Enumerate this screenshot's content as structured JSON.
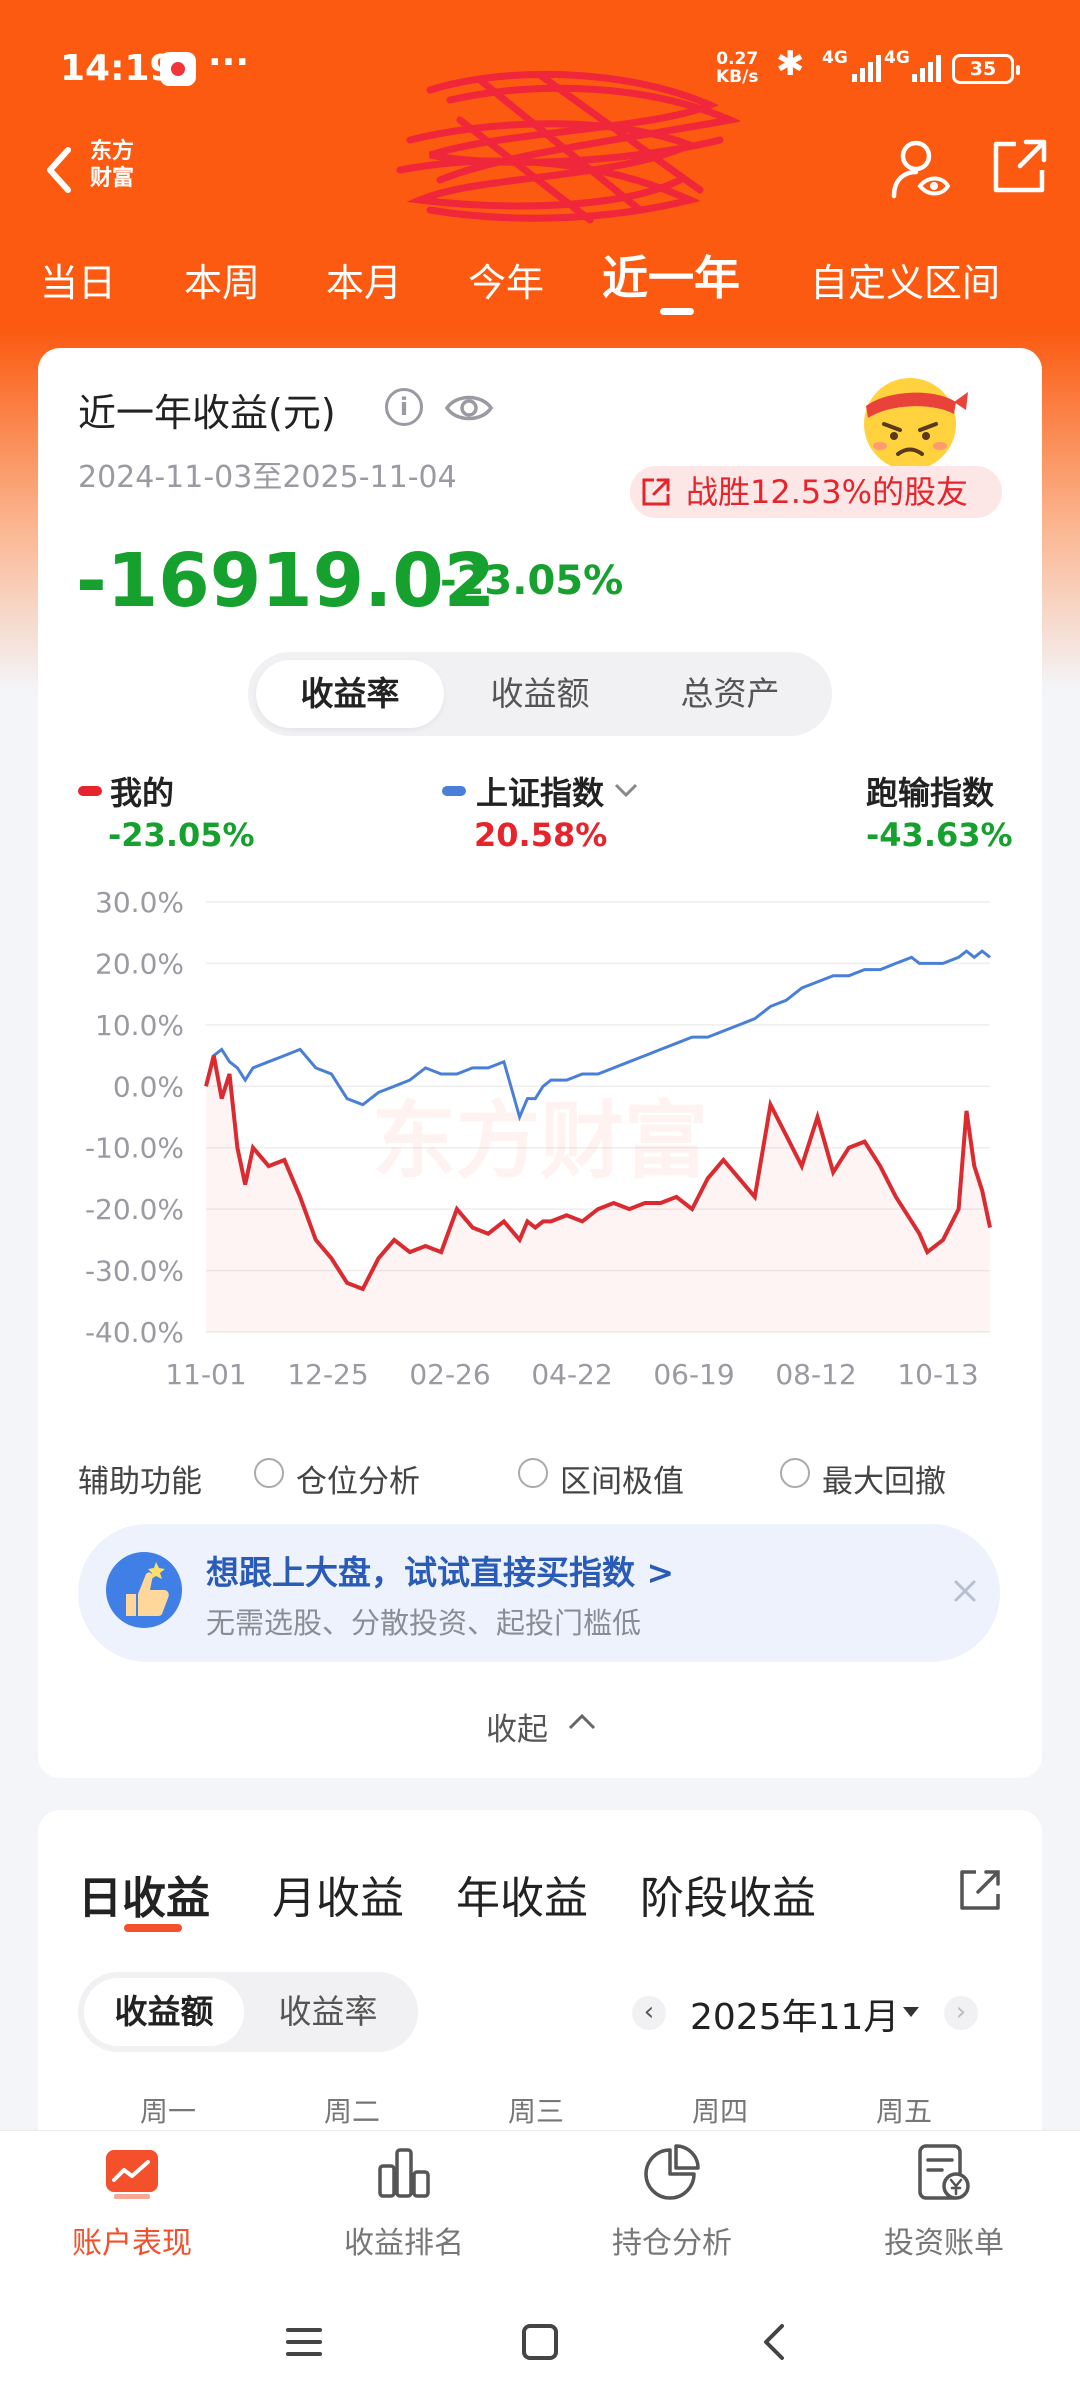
{
  "status_bar": {
    "time": "14:19",
    "more": "···",
    "net_speed_value": "0.27",
    "net_speed_unit": "KB/s",
    "signal_1": "4G",
    "signal_2": "4G",
    "battery": "35",
    "icons": [
      "app-notification-icon",
      "bluetooth-icon",
      "signal-icon",
      "battery-icon"
    ]
  },
  "header": {
    "back_icon": "back-arrow-icon",
    "brand_line1": "东方",
    "brand_line2": "财富",
    "title_obscured": "redacted-scribble",
    "user_icon": "user-eye-icon",
    "share_icon": "share-icon"
  },
  "period_tabs": [
    {
      "label": "当日"
    },
    {
      "label": "本周"
    },
    {
      "label": "本月"
    },
    {
      "label": "今年"
    },
    {
      "label": "近一年",
      "active": true
    },
    {
      "label": "自定义区间"
    }
  ],
  "summary": {
    "title": "近一年收益(元)",
    "date_range": "2024-11-03至2025-11-04",
    "beat_text": "战胜12.53%的股友",
    "total_value": "-16919.02",
    "total_pct": "-23.05%"
  },
  "segment": [
    "收益率",
    "收益额",
    "总资产"
  ],
  "legend": {
    "mine_name": "我的",
    "mine_value": "-23.05%",
    "index_name": "上证指数",
    "index_value": "20.58%",
    "diff_name": "跑输指数",
    "diff_value": "-43.63%"
  },
  "colors": {
    "brand_orange": "#fb5a10",
    "loss_green": "#16a02e",
    "gain_red": "#e5252b",
    "mine_line": "#d92b30",
    "index_line": "#4a7fd8",
    "active_accent": "#f4502b"
  },
  "chart_data": {
    "type": "line",
    "title": "",
    "watermark": "东方财富",
    "ylim": [
      -40,
      30
    ],
    "yticks": [
      "30.0%",
      "20.0%",
      "10.0%",
      "0.0%",
      "-10.0%",
      "-20.0%",
      "-30.0%",
      "-40.0%"
    ],
    "xticks": [
      "11-01",
      "12-25",
      "02-26",
      "04-22",
      "06-19",
      "08-12",
      "10-13"
    ],
    "x": [
      0,
      0.01,
      0.02,
      0.03,
      0.04,
      0.05,
      0.06,
      0.08,
      0.1,
      0.12,
      0.14,
      0.16,
      0.18,
      0.2,
      0.22,
      0.24,
      0.26,
      0.28,
      0.3,
      0.32,
      0.34,
      0.36,
      0.38,
      0.4,
      0.41,
      0.42,
      0.43,
      0.44,
      0.46,
      0.48,
      0.5,
      0.52,
      0.54,
      0.56,
      0.58,
      0.6,
      0.62,
      0.64,
      0.66,
      0.68,
      0.7,
      0.72,
      0.74,
      0.76,
      0.78,
      0.8,
      0.82,
      0.84,
      0.86,
      0.88,
      0.9,
      0.91,
      0.92,
      0.94,
      0.96,
      0.97,
      0.98,
      0.99,
      1.0
    ],
    "series": [
      {
        "name": "我的",
        "values": [
          0,
          5,
          -2,
          2,
          -10,
          -16,
          -10,
          -13,
          -12,
          -18,
          -25,
          -28,
          -32,
          -33,
          -28,
          -25,
          -27,
          -26,
          -27,
          -20,
          -23,
          -24,
          -22,
          -25,
          -22,
          -23,
          -22,
          -22,
          -21,
          -22,
          -20,
          -19,
          -20,
          -19,
          -19,
          -18,
          -20,
          -15,
          -12,
          -15,
          -18,
          -3,
          -8,
          -13,
          -5,
          -14,
          -10,
          -9,
          -13,
          -18,
          -22,
          -24,
          -27,
          -25,
          -20,
          -4,
          -13,
          -17,
          -23
        ]
      },
      {
        "name": "上证指数",
        "values": [
          0,
          5,
          6,
          4,
          3,
          1,
          3,
          4,
          5,
          6,
          3,
          2,
          -2,
          -3,
          -1,
          0,
          1,
          3,
          2,
          2,
          3,
          3,
          4,
          -5,
          -2,
          -2,
          0,
          1,
          1,
          2,
          2,
          3,
          4,
          5,
          6,
          7,
          8,
          8,
          9,
          10,
          11,
          13,
          14,
          16,
          17,
          18,
          18,
          19,
          19,
          20,
          21,
          20,
          20,
          20,
          21,
          22,
          21,
          22,
          21
        ]
      }
    ]
  },
  "aux": {
    "label": "辅助功能",
    "options": [
      "仓位分析",
      "区间极值",
      "最大回撤"
    ]
  },
  "promo": {
    "title": "想跟上大盘，试试直接买指数 >",
    "subtitle": "无需选股、分散投资、起投门槛低"
  },
  "collapse_label": "收起",
  "returns": {
    "tabs": [
      "日收益",
      "月收益",
      "年收益",
      "阶段收益"
    ],
    "segment": [
      "收益额",
      "收益率"
    ],
    "month": "2025年11月",
    "prev": "‹",
    "next": "›",
    "weekdays": [
      "周一",
      "周二",
      "周三",
      "周四",
      "周五"
    ]
  },
  "bottom_nav": [
    {
      "label": "账户表现",
      "icon": "account-chart-icon",
      "active": true
    },
    {
      "label": "收益排名",
      "icon": "ranking-bars-icon"
    },
    {
      "label": "持仓分析",
      "icon": "pie-chart-icon"
    },
    {
      "label": "投资账单",
      "icon": "bill-icon"
    }
  ],
  "system_nav": [
    "menu-icon",
    "home-icon",
    "back-icon"
  ]
}
